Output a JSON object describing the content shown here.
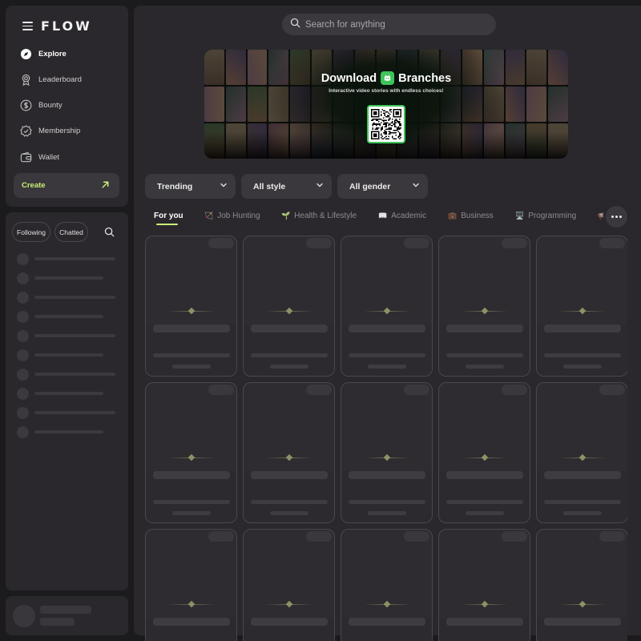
{
  "app": {
    "logo_text": "FLOW"
  },
  "sidebar": {
    "nav": [
      {
        "label": "Explore",
        "icon": "compass-icon",
        "active": true
      },
      {
        "label": "Leaderboard",
        "icon": "badge-icon",
        "active": false
      },
      {
        "label": "Bounty",
        "icon": "dollar-coin-icon",
        "active": false
      },
      {
        "label": "Membership",
        "icon": "verified-seal-icon",
        "active": false
      },
      {
        "label": "Wallet",
        "icon": "wallet-icon",
        "active": false
      }
    ],
    "create_label": "Create",
    "filters": {
      "following": "Following",
      "chatted": "Chatted"
    }
  },
  "search": {
    "placeholder": "Search for anything"
  },
  "banner": {
    "title_prefix": "Download",
    "title_app": "Branches",
    "subtitle": "Interactive video stories with endless choices!"
  },
  "filters": [
    {
      "label": "Trending"
    },
    {
      "label": "All style"
    },
    {
      "label": "All gender"
    }
  ],
  "tabs": [
    {
      "label": "For you",
      "emoji": ""
    },
    {
      "label": "Job Hunting",
      "emoji": "🏹"
    },
    {
      "label": "Health & Lifestyle",
      "emoji": "🌱"
    },
    {
      "label": "Academic",
      "emoji": "📖"
    },
    {
      "label": "Business",
      "emoji": "💼"
    },
    {
      "label": "Programming",
      "emoji": "🖥️"
    },
    {
      "label": "",
      "emoji": "📢"
    }
  ],
  "colors": {
    "accent": "#c9ef76",
    "brand_green": "#3ec45a",
    "panel": "#2a282c",
    "background": "#1b1a1d"
  }
}
